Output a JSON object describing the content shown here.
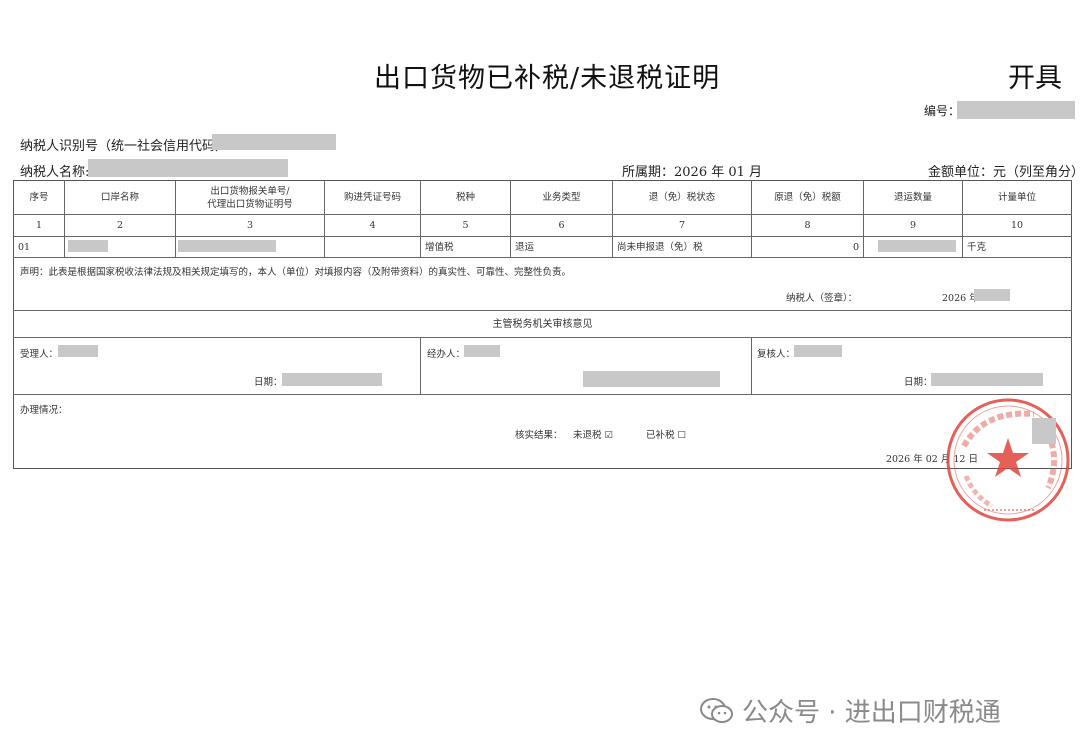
{
  "document": {
    "title": "出口货物已补税/未退税证明",
    "issue_label": "开具",
    "number_label": "编号：",
    "taxpayer_id_label": "纳税人识别号（统一社会信用代码）：",
    "taxpayer_name_label": "纳税人名称:",
    "period_label": "所属期：2026 年 01 月",
    "amount_unit_label": "金额单位：元（列至角分）"
  },
  "table": {
    "headers": [
      "序号",
      "口岸名称",
      "出口货物报关单号/代理出口货物证明号",
      "购进凭证号码",
      "税种",
      "业务类型",
      "退（免）税状态",
      "原退（免）税额",
      "退运数量",
      "计量单位"
    ],
    "header_line1": "出口货物报关单号/",
    "header_line2": "代理出口货物证明号",
    "column_numbers": [
      "1",
      "2",
      "3",
      "4",
      "5",
      "6",
      "7",
      "8",
      "9",
      "10"
    ],
    "row": {
      "seq": "01",
      "tax_type": "增值税",
      "business_type": "退运",
      "status": "尚未申报退（免）税",
      "original_amount": "0",
      "unit": "千克"
    }
  },
  "declaration": {
    "text": "声明：此表是根据国家税收法律法规及相关规定填写的，本人（单位）对填报内容（及附带资料）的真实性、可靠性、完整性负责。",
    "signer_label": "纳税人（签章）：",
    "sign_date": "2026 年"
  },
  "review": {
    "heading": "主管税务机关审核意见",
    "receiver_label": "受理人：",
    "handler_label": "经办人：",
    "reviewer_label": "复核人：",
    "date_label": "日期：",
    "date_label_2": "日期："
  },
  "processing": {
    "label": "办理情况：",
    "result_label": "核实结果：",
    "option_unrefunded": "未退税",
    "option_unrefunded_mark": "☑",
    "option_supplemented": "已补税",
    "option_supplemented_mark": "☐",
    "date": "2026 年 02 月 12 日"
  },
  "watermark": {
    "text": "公众号 · 进出口财税通"
  },
  "colors": {
    "stamp": "#e0443c",
    "redaction": "#c8c8c8",
    "watermark": "#8a8a8a"
  }
}
